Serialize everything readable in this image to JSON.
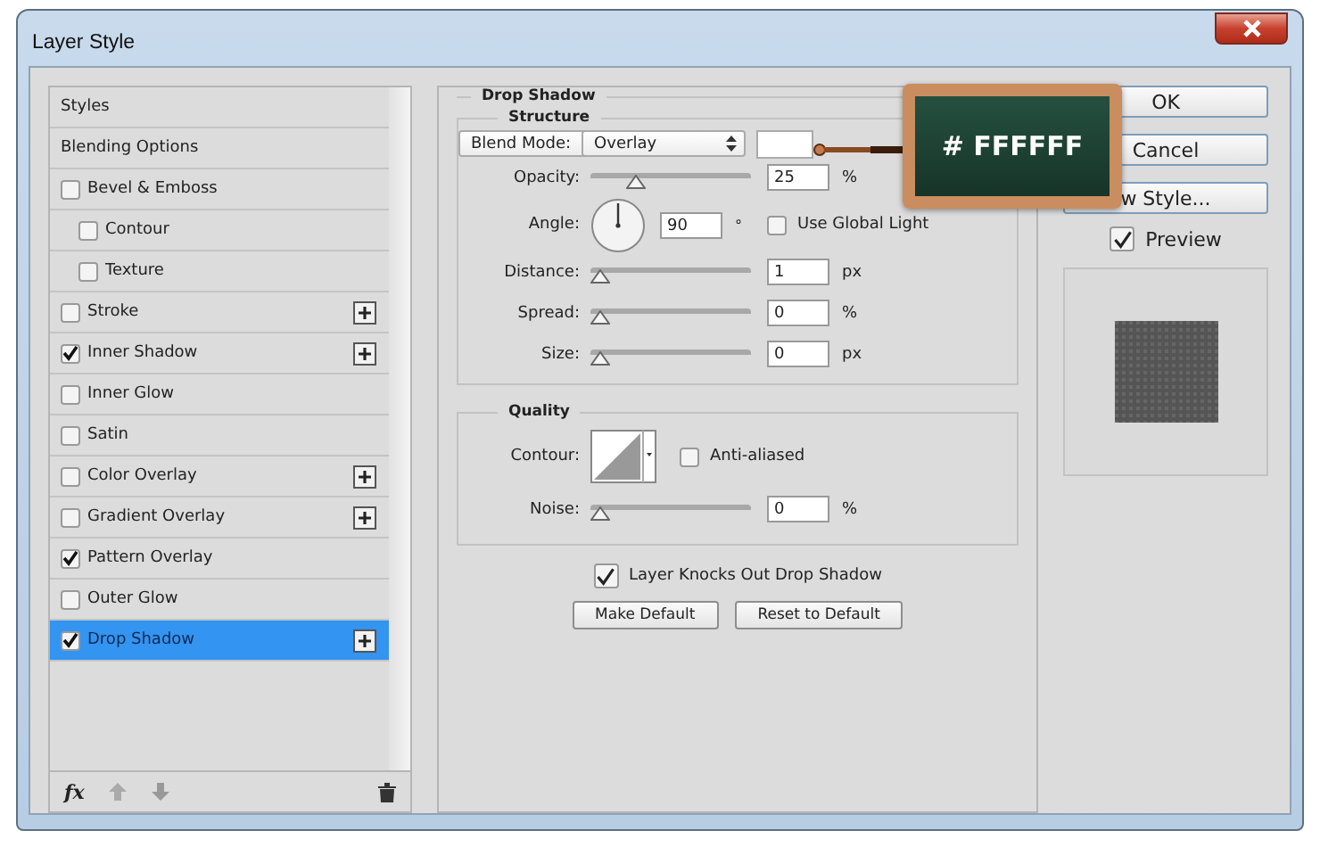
{
  "window": {
    "title": "Layer Style"
  },
  "sidebar": {
    "items": [
      {
        "label": "Styles",
        "kind": "plain",
        "selected": false
      },
      {
        "label": "Blending Options",
        "kind": "plain",
        "selected": false
      },
      {
        "label": "Bevel & Emboss",
        "kind": "checkbox",
        "checked": false,
        "selected": false,
        "add": false,
        "children": [
          {
            "label": "Contour",
            "kind": "checkbox",
            "checked": false,
            "selected": false,
            "add": false
          },
          {
            "label": "Texture",
            "kind": "checkbox",
            "checked": false,
            "selected": false,
            "add": false
          }
        ]
      },
      {
        "label": "Stroke",
        "kind": "checkbox",
        "checked": false,
        "selected": false,
        "add": true
      },
      {
        "label": "Inner Shadow",
        "kind": "checkbox",
        "checked": true,
        "selected": false,
        "add": true
      },
      {
        "label": "Inner Glow",
        "kind": "checkbox",
        "checked": false,
        "selected": false,
        "add": false
      },
      {
        "label": "Satin",
        "kind": "checkbox",
        "checked": false,
        "selected": false,
        "add": false
      },
      {
        "label": "Color Overlay",
        "kind": "checkbox",
        "checked": false,
        "selected": false,
        "add": true
      },
      {
        "label": "Gradient Overlay",
        "kind": "checkbox",
        "checked": false,
        "selected": false,
        "add": true
      },
      {
        "label": "Pattern Overlay",
        "kind": "checkbox",
        "checked": true,
        "selected": false,
        "add": false
      },
      {
        "label": "Outer Glow",
        "kind": "checkbox",
        "checked": false,
        "selected": false,
        "add": false
      },
      {
        "label": "Drop Shadow",
        "kind": "checkbox",
        "checked": true,
        "selected": true,
        "add": true
      }
    ],
    "footer": {
      "fx": "fx"
    }
  },
  "panel": {
    "title": "Drop Shadow",
    "structure": {
      "title": "Structure",
      "rows": [
        {
          "kind": "select",
          "label": "Blend Mode:",
          "value": "Overlay"
        },
        {
          "kind": "slider",
          "label": "Opacity:",
          "level": 0.25,
          "value": "25",
          "unit": "%"
        },
        {
          "kind": "angle",
          "label": "Angle:",
          "value": "90",
          "unit": "°",
          "option": {
            "label": "Use Global Light",
            "checked": false
          }
        },
        {
          "kind": "slider",
          "label": "Distance:",
          "level": 0,
          "value": "1",
          "unit": "px"
        },
        {
          "kind": "slider",
          "label": "Spread:",
          "level": 0,
          "value": "0",
          "unit": "%"
        },
        {
          "kind": "slider",
          "label": "Size:",
          "level": 0,
          "value": "0",
          "unit": "px"
        }
      ]
    },
    "quality": {
      "title": "Quality",
      "rows": [
        {
          "kind": "contour",
          "label": "Contour:",
          "option": {
            "label": "Anti-aliased",
            "checked": false
          }
        },
        {
          "kind": "slider",
          "label": "Noise:",
          "level": 0,
          "value": "0",
          "unit": "%"
        }
      ]
    },
    "knockout": {
      "label": "Layer Knocks Out Drop Shadow",
      "checked": true
    },
    "buttons": [
      "Make Default",
      "Reset to Default"
    ]
  },
  "actions": {
    "buttons": [
      "OK",
      "Cancel",
      "w Style..."
    ],
    "preview": {
      "label": "Preview",
      "checked": true
    }
  },
  "callout": {
    "text": "# FFFFFF"
  }
}
